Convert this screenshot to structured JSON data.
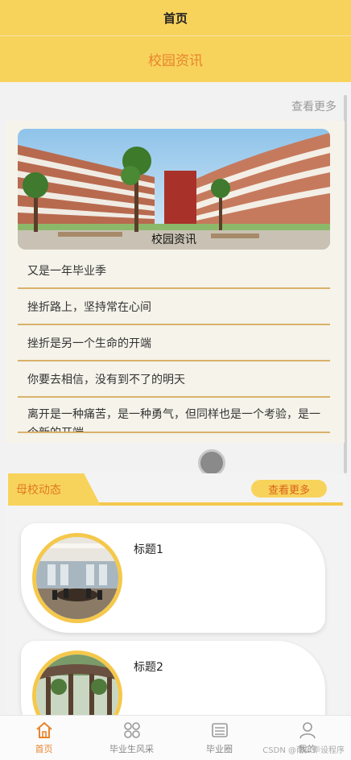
{
  "header": {
    "title": "首页"
  },
  "campus_news": {
    "section_title": "校园资讯",
    "more_label": "查看更多",
    "image_caption": "校园资讯",
    "items": [
      "又是一年毕业季",
      "挫折路上，坚持常在心间",
      "挫折是另一个生命的开端",
      "你要去相信，没有到不了的明天",
      "离开是一种痛苦，是一种勇气，但同样也是一个考验，是一个新的开端"
    ]
  },
  "alumni_news": {
    "section_title": "母校动态",
    "more_label": "查看更多",
    "cards": [
      {
        "title": "标题1"
      },
      {
        "title": "标题2"
      }
    ]
  },
  "tabbar": {
    "tabs": [
      {
        "label": "首页",
        "icon": "home-icon",
        "active": true
      },
      {
        "label": "毕业生风采",
        "icon": "grid-icon",
        "active": false
      },
      {
        "label": "毕业圈",
        "icon": "board-icon",
        "active": false
      },
      {
        "label": "我的",
        "icon": "user-icon",
        "active": false
      }
    ]
  },
  "watermark": "CSDN @南瓜毕设程序",
  "colors": {
    "primary": "#f8d35c",
    "accent": "#e8842d",
    "divider": "#d9b16a"
  }
}
